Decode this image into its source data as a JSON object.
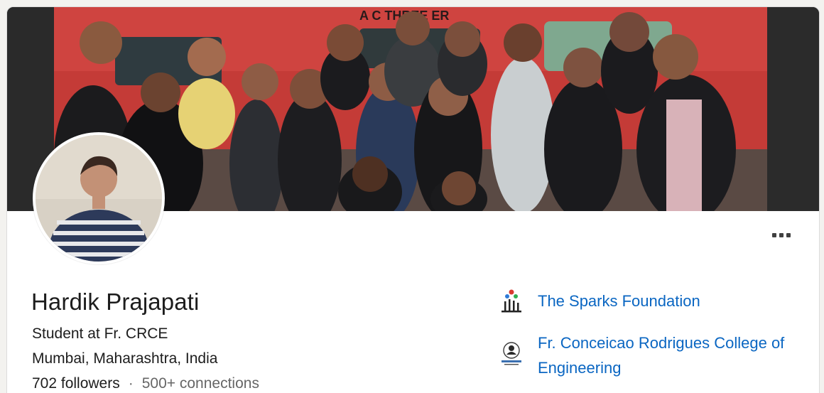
{
  "profile": {
    "name": "Hardik Prajapati",
    "headline": "Student at Fr. CRCE",
    "location": "Mumbai, Maharashtra, India",
    "followers": "702 followers",
    "separator": "·",
    "connections": "500+ connections"
  },
  "cover": {
    "sign_text": "A C THREE  ER"
  },
  "organizations": [
    {
      "name": "The Sparks Foundation",
      "logo_icon": "sparks-foundation-logo"
    },
    {
      "name": "Fr. Conceicao Rodrigues College of Engineering",
      "logo_icon": "crce-logo"
    }
  ],
  "actions": {
    "more_icon": "more-horizontal-icon"
  },
  "colors": {
    "link": "#0a66c2",
    "text": "#1d1d1d",
    "muted": "#666666",
    "cover_red": "#c9302c"
  }
}
